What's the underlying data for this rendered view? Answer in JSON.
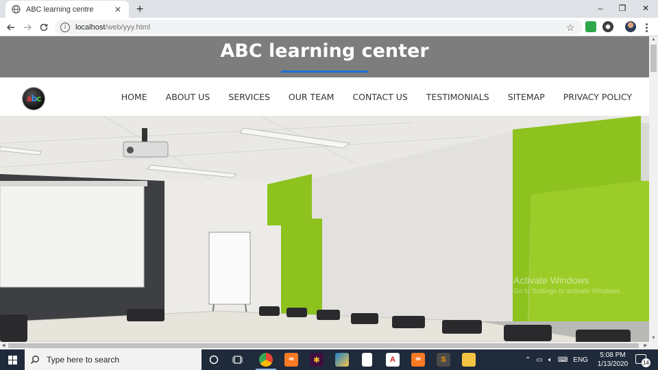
{
  "browser": {
    "tab_title": "ABC learning centre",
    "tab_close": "✕",
    "new_tab": "+",
    "url_host": "localhost",
    "url_path": "/web/yyy.html",
    "window_controls": [
      "–",
      "❐",
      "✕"
    ]
  },
  "page": {
    "heading": "ABC learning center",
    "logo_letters": {
      "a": "a",
      "b": "b",
      "c": "c"
    },
    "nav": [
      "HOME",
      "ABOUT US",
      "SERVICES",
      "OUR TEAM",
      "CONTACT US",
      "TESTIMONIALS",
      "SITEMAP",
      "PRIVACY POLICY"
    ],
    "watermark_title": "Activate Windows",
    "watermark_sub": "Go to Settings to activate Windows.",
    "accent_color": "#1e6fd9",
    "header_bg": "#7d7d7d"
  },
  "taskbar": {
    "search_placeholder": "Type here to search",
    "language": "ENG",
    "time": "5:08 PM",
    "date": "1/13/2020",
    "notification_count": "14",
    "apps": [
      {
        "name": "chrome-icon",
        "label": ""
      },
      {
        "name": "xampp-icon",
        "label": "ꟹ"
      },
      {
        "name": "slack-icon",
        "label": "✱"
      },
      {
        "name": "paint-icon",
        "label": ""
      },
      {
        "name": "file-icon",
        "label": ""
      },
      {
        "name": "acrobat-icon",
        "label": "A"
      },
      {
        "name": "xampp2-icon",
        "label": "ꟹ"
      },
      {
        "name": "sublime-icon",
        "label": "S"
      },
      {
        "name": "explorer-icon",
        "label": ""
      }
    ]
  }
}
